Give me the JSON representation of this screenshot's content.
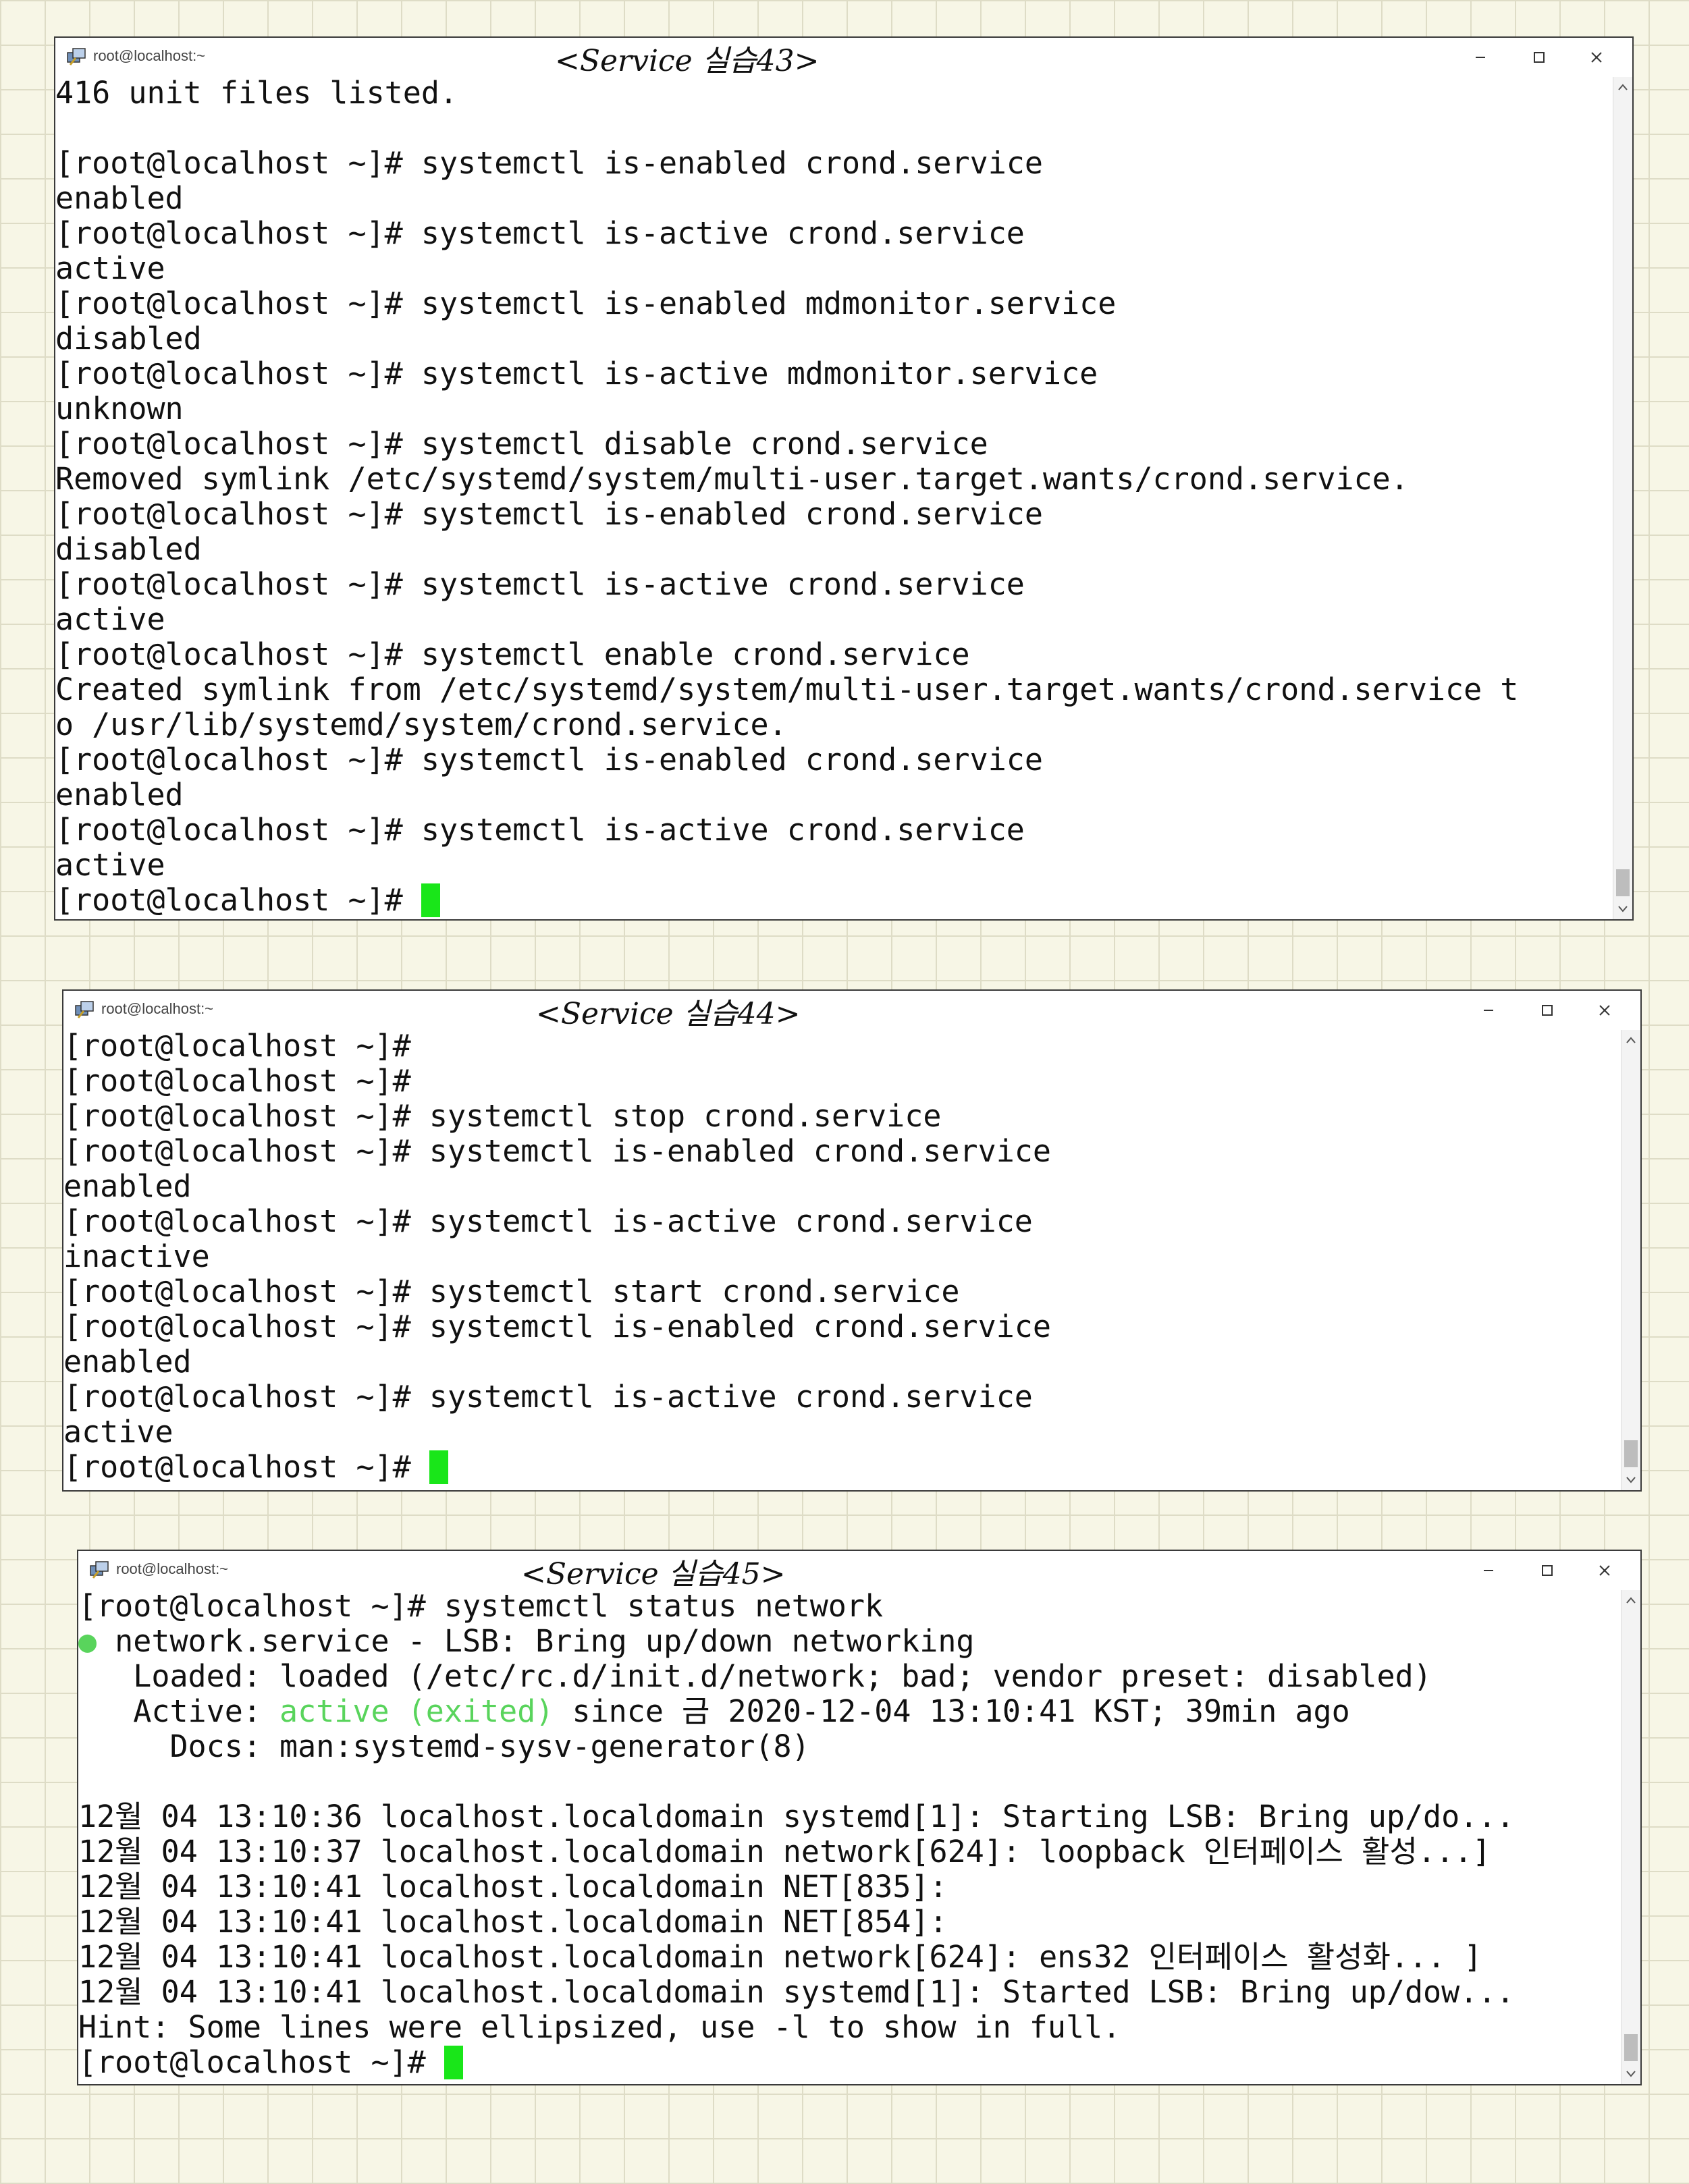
{
  "windows": [
    {
      "title": "root@localhost:~",
      "annotation": "<Service 실습43>",
      "lines": [
        "416 unit files listed.",
        "",
        "[root@localhost ~]# systemctl is-enabled crond.service",
        "enabled",
        "[root@localhost ~]# systemctl is-active crond.service",
        "active",
        "[root@localhost ~]# systemctl is-enabled mdmonitor.service",
        "disabled",
        "[root@localhost ~]# systemctl is-active mdmonitor.service",
        "unknown",
        "[root@localhost ~]# systemctl disable crond.service",
        "Removed symlink /etc/systemd/system/multi-user.target.wants/crond.service.",
        "[root@localhost ~]# systemctl is-enabled crond.service",
        "disabled",
        "[root@localhost ~]# systemctl is-active crond.service",
        "active",
        "[root@localhost ~]# systemctl enable crond.service",
        "Created symlink from /etc/systemd/system/multi-user.target.wants/crond.service t",
        "o /usr/lib/systemd/system/crond.service.",
        "[root@localhost ~]# systemctl is-enabled crond.service",
        "enabled",
        "[root@localhost ~]# systemctl is-active crond.service",
        "active"
      ],
      "prompt": "[root@localhost ~]# "
    },
    {
      "title": "root@localhost:~",
      "annotation": "<Service 실습44>",
      "lines": [
        "[root@localhost ~]#",
        "[root@localhost ~]#",
        "[root@localhost ~]# systemctl stop crond.service",
        "[root@localhost ~]# systemctl is-enabled crond.service",
        "enabled",
        "[root@localhost ~]# systemctl is-active crond.service",
        "inactive",
        "[root@localhost ~]# systemctl start crond.service",
        "[root@localhost ~]# systemctl is-enabled crond.service",
        "enabled",
        "[root@localhost ~]# systemctl is-active crond.service",
        "active"
      ],
      "prompt": "[root@localhost ~]# "
    },
    {
      "title": "root@localhost:~",
      "annotation": "<Service 실습45>",
      "status": {
        "command_line": "[root@localhost ~]# systemctl status network",
        "dot": "●",
        "service_line": " network.service - LSB: Bring up/down networking",
        "loaded_line": "   Loaded: loaded (/etc/rc.d/init.d/network; bad; vendor preset: disabled)",
        "active_prefix": "   Active: ",
        "active_state": "active (exited)",
        "active_suffix": " since 금 2020-12-04 13:10:41 KST; 39min ago",
        "docs_line": "     Docs: man:systemd-sysv-generator(8)",
        "log_lines": [
          "12월 04 13:10:36 localhost.localdomain systemd[1]: Starting LSB: Bring up/do...",
          "12월 04 13:10:37 localhost.localdomain network[624]: loopback 인터페이스 활성...]",
          "12월 04 13:10:41 localhost.localdomain NET[835]:",
          "12월 04 13:10:41 localhost.localdomain NET[854]:",
          "12월 04 13:10:41 localhost.localdomain network[624]: ens32 인터페이스 활성화... ]",
          "12월 04 13:10:41 localhost.localdomain systemd[1]: Started LSB: Bring up/dow..."
        ],
        "hint_line": "Hint: Some lines were ellipsized, use -l to show in full."
      },
      "prompt": "[root@localhost ~]# "
    }
  ]
}
